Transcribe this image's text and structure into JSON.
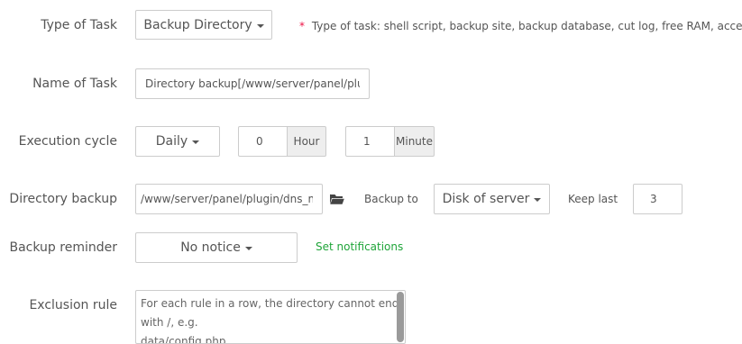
{
  "form": {
    "type_of_task": {
      "label": "Type of Task",
      "value": "Backup Directory",
      "hint_star": "*",
      "hint": "Type of task: shell script, backup site, backup database, cut log, free RAM, access UR"
    },
    "name_of_task": {
      "label": "Name of Task",
      "value": "Directory backup[/www/server/panel/plu"
    },
    "execution_cycle": {
      "label": "Execution cycle",
      "period": "Daily",
      "hour_value": "0",
      "hour_unit": "Hour",
      "minute_value": "1",
      "minute_unit": "Minute"
    },
    "directory_backup": {
      "label": "Directory backup",
      "path": "/www/server/panel/plugin/dns_ma",
      "folder_icon": "folder-open-icon",
      "backup_to_label": "Backup to",
      "backup_to_value": "Disk of server",
      "keep_last_label": "Keep last",
      "keep_last_value": "3"
    },
    "backup_reminder": {
      "label": "Backup reminder",
      "value": "No notice",
      "set_notifications": "Set notifications"
    },
    "exclusion_rule": {
      "label": "Exclusion rule",
      "placeholder_line1": "For each rule in a row, the directory cannot end",
      "placeholder_line2": "with /, e.g.",
      "placeholder_line3": "data/config.php"
    }
  },
  "colors": {
    "accent_green": "#20a53a",
    "required_star": "#ee1144",
    "border": "#cccccc",
    "addon_bg": "#eeeeee"
  }
}
